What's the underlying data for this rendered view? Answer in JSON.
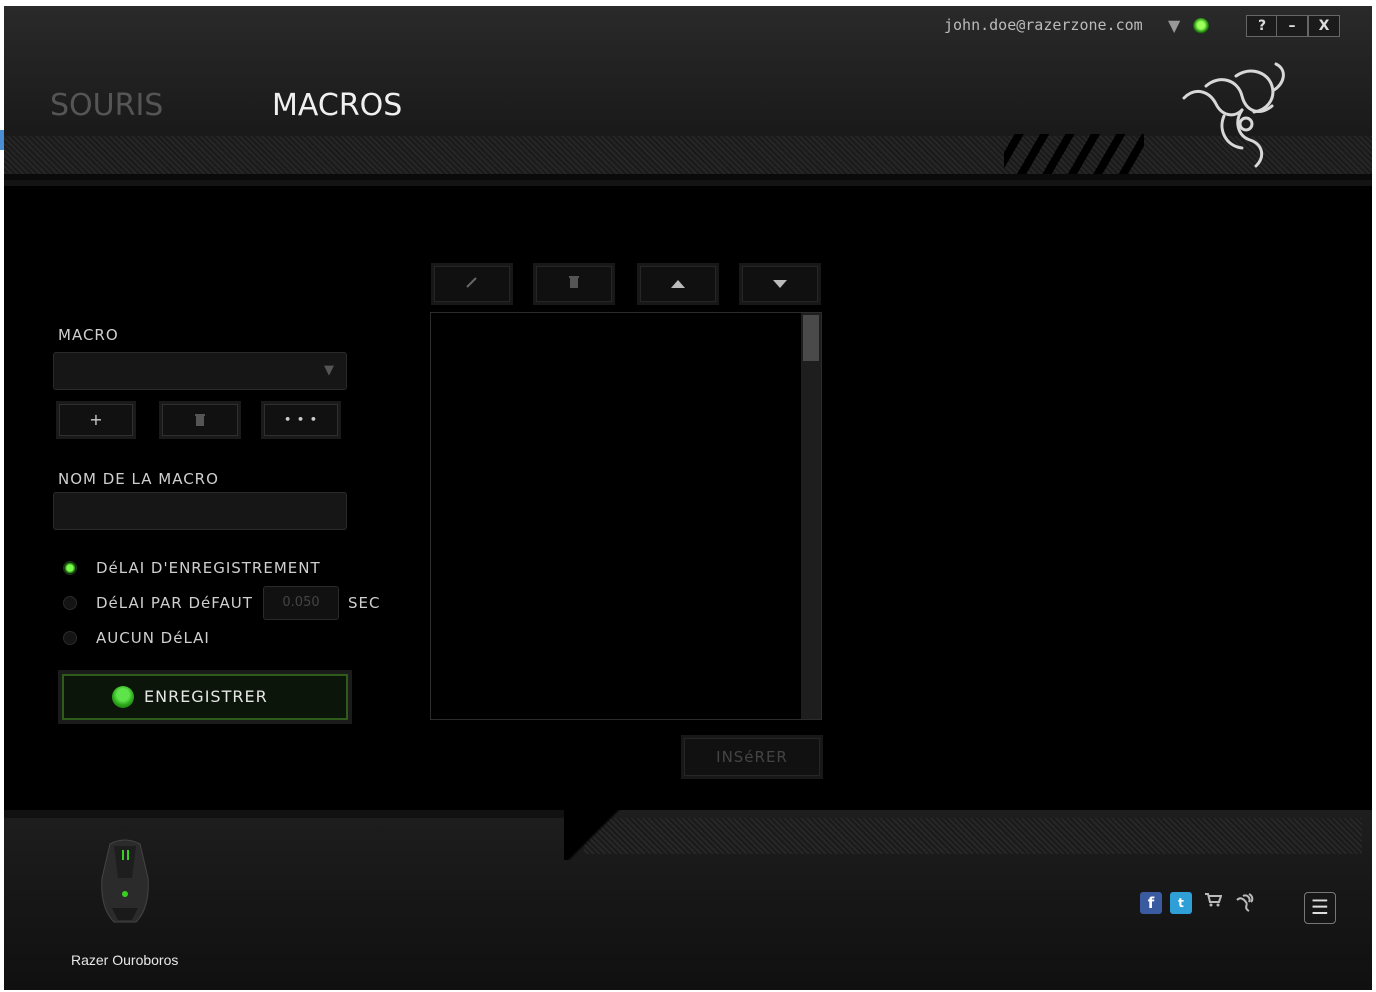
{
  "account": {
    "email": "john.doe@razerzone.com",
    "dropdown_icon": "chevron-down-icon",
    "status_color": "#44c21e"
  },
  "window_controls": {
    "help": "?",
    "minimize": "–",
    "close": "X"
  },
  "tabs": [
    {
      "label": "SOURIS",
      "active": false
    },
    {
      "label": "MACROS",
      "active": true
    }
  ],
  "macro_panel": {
    "macro_label": "MACRO",
    "macro_select_value": "",
    "add_button": "+",
    "delete_icon": "trash-icon",
    "more_button": "• • •",
    "name_label": "NOM DE LA MACRO",
    "name_value": "",
    "delay_options": [
      {
        "label": "DéLAI D'ENREGISTREMENT",
        "selected": true
      },
      {
        "label": "DéLAI PAR DéFAUT",
        "selected": false
      },
      {
        "label": "AUCUN DéLAI",
        "selected": false
      }
    ],
    "default_delay_value": "0.050",
    "default_delay_unit": "SEC",
    "record_button": "ENREGISTRER"
  },
  "editor_panel": {
    "tools": [
      "pencil-icon",
      "trash-icon",
      "arrow-up-icon",
      "arrow-down-icon"
    ],
    "insert_button": "INSéRER"
  },
  "footer": {
    "device_name": "Razer Ouroboros",
    "social": [
      "facebook-icon",
      "twitter-icon",
      "cart-icon",
      "razer-icon"
    ],
    "menu_icon": "menu-icon"
  },
  "colors": {
    "accent_green": "#44c21e",
    "background": "#000000"
  }
}
